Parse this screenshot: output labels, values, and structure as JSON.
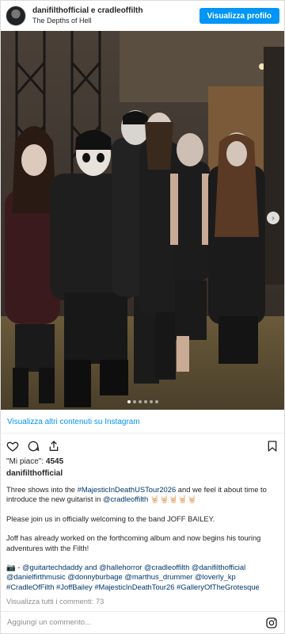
{
  "header": {
    "username": "danifilthofficial e cradleoffilth",
    "location": "The Depths of Hell",
    "profile_button": "Visualizza profilo"
  },
  "more_link": "Visualizza altri contenuti su Instagram",
  "actions": {
    "like_icon": "heart-icon",
    "comment_icon": "comment-icon",
    "share_icon": "share-icon",
    "save_icon": "bookmark-icon"
  },
  "likes": {
    "label": "\"Mi piace\":",
    "count": "4545"
  },
  "caption": {
    "username": "danifilthofficial",
    "p1_a": "Three shows into the ",
    "p1_tag": "#MajesticInDeathUSTour2026",
    "p1_b": " and we feel it about time to introduce the new guitarist in ",
    "p1_mention": "@cradleoffilth",
    "p1_emoji": " 🤘🏻🤘🏻🤘🏻🤘🏻🤘🏻",
    "p2": "Please join us in officially welcoming to the band JOFF BAILEY.",
    "p3": "Joff has already worked on the forthcoming album and now begins his touring adventures with the Filth!",
    "p4_prefix": "📷 - ",
    "p4_tags": "@guitartechdaddy and @hallehorror @cradleoffilth @danifilthofficial @danielfirthmusic @donnyburbage @marthus_drummer @loverly_kp #CradleOfFilth #JoffBailey #MajesticInDeathTour26 #GalleryOfTheGrotesque"
  },
  "comments_link": "Visualizza tutti i commenti: 73",
  "comment_input": {
    "placeholder": "Aggiungi un commento..."
  },
  "carousel": {
    "total_slides": 6,
    "current_slide": 1
  }
}
